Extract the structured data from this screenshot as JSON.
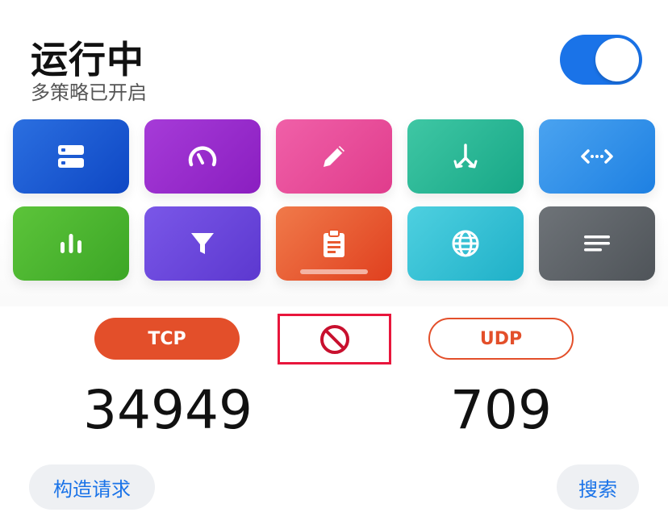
{
  "header": {
    "title": "运行中",
    "subtitle": "多策略已开启",
    "toggle_on": true
  },
  "tiles": [
    {
      "icon": "server-icon",
      "color_from": "#2b6fe0",
      "color_to": "#0e47c4"
    },
    {
      "icon": "speedometer-icon",
      "color_from": "#a63bd8",
      "color_to": "#8a1ec0"
    },
    {
      "icon": "pencil-icon",
      "color_from": "#f060a8",
      "color_to": "#e03c8c"
    },
    {
      "icon": "fork-arrows-icon",
      "color_from": "#3fc7a4",
      "color_to": "#17a787"
    },
    {
      "icon": "code-arrows-icon",
      "color_from": "#4aa3f0",
      "color_to": "#1e80e2"
    },
    {
      "icon": "bar-chart-icon",
      "color_from": "#5cc43a",
      "color_to": "#3ca626"
    },
    {
      "icon": "filter-icon",
      "color_from": "#7a57e8",
      "color_to": "#5c38cf"
    },
    {
      "icon": "clipboard-icon",
      "color_from": "#f07a4a",
      "color_to": "#e0401f"
    },
    {
      "icon": "globe-icon",
      "color_from": "#4ed0e0",
      "color_to": "#1fb0c8"
    },
    {
      "icon": "lines-icon",
      "color_from": "#6e7378",
      "color_to": "#4f5459"
    }
  ],
  "stats": {
    "tcp_label": "TCP",
    "udp_label": "UDP",
    "tcp_count": "34949",
    "udp_count": "709"
  },
  "actions": {
    "construct_request": "构造请求",
    "search": "搜索"
  },
  "colors": {
    "accent": "#1a73e8",
    "tcp": "#e34f2a",
    "highlight": "#e8163c"
  }
}
